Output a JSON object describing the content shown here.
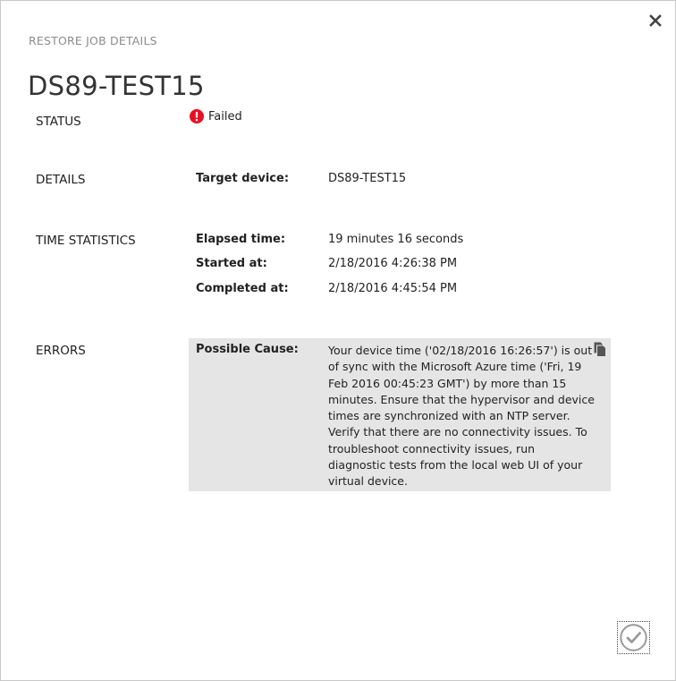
{
  "dialog": {
    "label": "RESTORE JOB DETAILS",
    "title": "DS89-TEST15"
  },
  "status": {
    "section_label": "STATUS",
    "value": "Failed",
    "icon": "error-icon",
    "icon_color": "#e81123"
  },
  "details": {
    "section_label": "DETAILS",
    "target_device_label": "Target device:",
    "target_device_value": "DS89-TEST15"
  },
  "time_statistics": {
    "section_label": "TIME STATISTICS",
    "elapsed_label": "Elapsed time:",
    "elapsed_value": "19 minutes 16 seconds",
    "started_label": "Started at:",
    "started_value": "2/18/2016 4:26:38 PM",
    "completed_label": "Completed at:",
    "completed_value": "2/18/2016 4:45:54 PM"
  },
  "errors": {
    "section_label": "ERRORS",
    "cause_label": "Possible Cause:",
    "cause_text": "Your device time ('02/18/2016 16:26:57') is out of sync with the Microsoft Azure time ('Fri, 19 Feb 2016 00:45:23 GMT') by more than 15 minutes. Ensure that the hypervisor and device times are synchronized with an NTP server. Verify that there are no connectivity issues. To troubleshoot connectivity issues, run diagnostic tests from the local web UI of your virtual device.",
    "box_color": "#e5e5e5"
  },
  "icons": {
    "close": "close-icon",
    "copy": "copy-icon",
    "ok": "checkmark-icon"
  }
}
